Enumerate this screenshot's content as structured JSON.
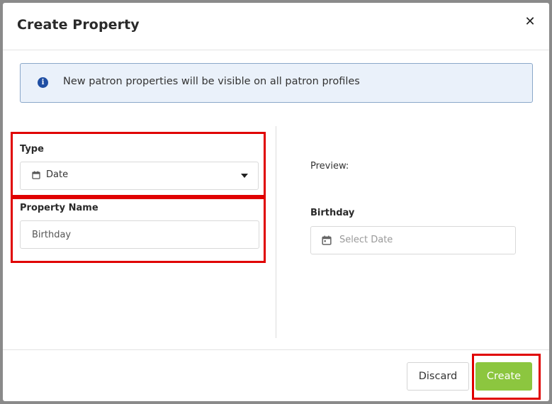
{
  "modal": {
    "title": "Create Property",
    "close_icon": "close-icon",
    "close_glyph": "✕"
  },
  "banner": {
    "icon": "info-icon",
    "icon_glyph": "i",
    "text": "New patron properties will be visible on all patron profiles"
  },
  "form": {
    "type_label": "Type",
    "type_value": "Date",
    "type_icon": "calendar-icon",
    "property_name_label": "Property Name",
    "property_name_value": "Birthday"
  },
  "preview": {
    "label": "Preview:",
    "field_label": "Birthday",
    "date_placeholder": "Select Date",
    "date_icon": "calendar-icon"
  },
  "footer": {
    "discard_label": "Discard",
    "create_label": "Create"
  },
  "colors": {
    "accent_green": "#8cc63f",
    "info_blue": "#1f4ea3",
    "banner_bg": "#eaf1fa",
    "annotation_red": "#e00000"
  }
}
